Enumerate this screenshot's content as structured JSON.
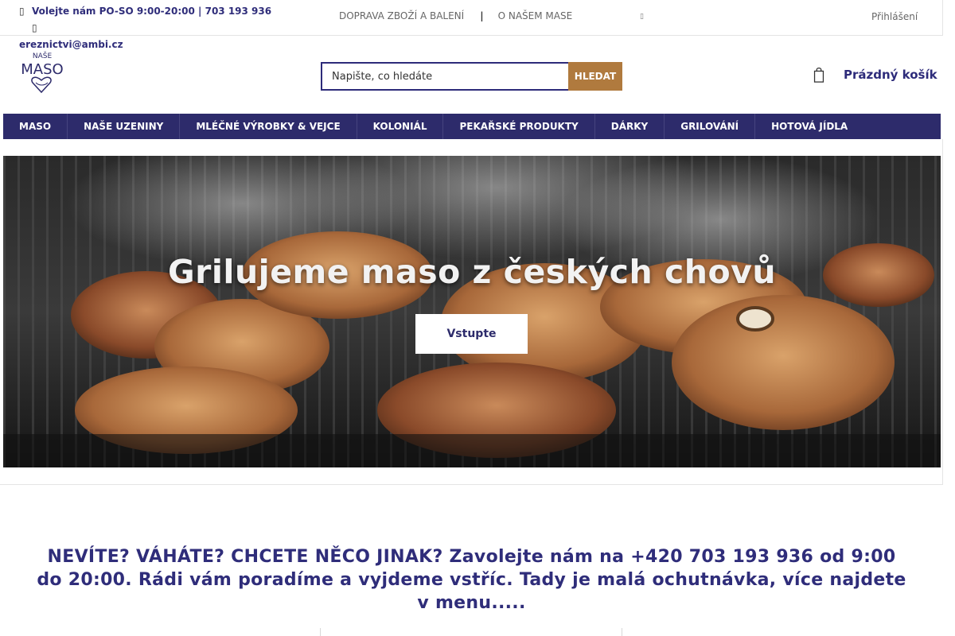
{
  "topbar": {
    "phone_text": "Volejte nám PO-SO 9:00-20:00 | 703 193 936",
    "email_text": "ereznictvi@ambi.cz",
    "links": [
      "DOPRAVA ZBOŽÍ A BALENÍ",
      "O NAŠEM MASE"
    ],
    "separator": "|",
    "login_label": "Přihlášení"
  },
  "logo": {
    "top_text": "NAŠE",
    "main_text": "MASO"
  },
  "search": {
    "placeholder": "Napište, co hledáte",
    "button_label": "HLEDAT"
  },
  "cart": {
    "label": "Prázdný košík",
    "icon": "shopping-bag-icon"
  },
  "nav": {
    "items": [
      "MASO",
      "NAŠE UZENINY",
      "MLÉČNÉ VÝROBKY & VEJCE",
      "KOLONIÁL",
      "PEKAŘSKÉ PRODUKTY",
      "DÁRKY",
      "GRILOVÁNÍ",
      "HOTOVÁ JÍDLA"
    ]
  },
  "hero": {
    "title": "Grilujeme maso z českých chovů",
    "button_label": "Vstupte"
  },
  "promo": {
    "text": "NEVÍTE? VÁHÁTE? CHCETE NĚCO JINAK? Zavolejte nám na +420 703 193 936 od 9:00 do 20:00. Rádi vám poradíme a vyjdeme vstříc. Tady je malá ochutnávka, více najdete v menu....."
  },
  "colors": {
    "brand": "#2d2b6b",
    "accent": "#b07a3e"
  }
}
